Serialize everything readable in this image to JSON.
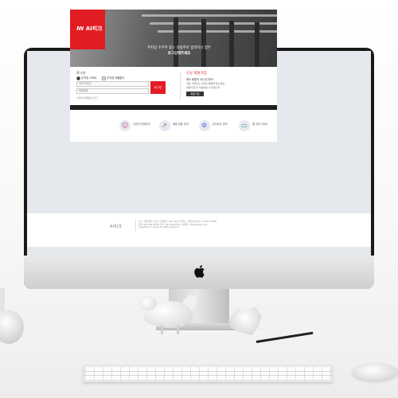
{
  "brand": {
    "logo_text": "AI피크"
  },
  "hero": {
    "line1": "주차장 수주주 찾는 설정주로 입력하신 업무",
    "line2": "로그인해주세요"
  },
  "login": {
    "title": "로그인",
    "option_personal": "주차장 스마트",
    "option_other": "주차장 자율없이",
    "id_placeholder": "이디 아이디",
    "pw_placeholder": "비밀번호",
    "button_label": "로그인",
    "find_text": "아이디/비밀번호 찾기"
  },
  "join": {
    "title": "신규 회원가입",
    "question": "에서 회원이 아니신가요?",
    "desc_line1": "지금 가입하고 다양한 혜택을 받으세요",
    "desc_line2": "회원가입 후 이용하실 수 있습니다",
    "button_label": "회원가입"
  },
  "services": [
    {
      "icon": "person-icon",
      "glyph": "☺",
      "label": "인공지 연계관리"
    },
    {
      "icon": "chart-icon",
      "glyph": "↗",
      "label": "매출 현황 관리"
    },
    {
      "icon": "gear-icon",
      "glyph": "⚙",
      "label": "유지보수 관리"
    },
    {
      "icon": "monitor-icon",
      "glyph": "▭",
      "label": "웹 관리 서비스"
    }
  ],
  "footer": {
    "logo_text": "AI피크",
    "line1": "주소: 서울특별시 강남구 테헤란로 123 | 대표: 홍길동 | 사업자등록번호: 123-45-67890",
    "line2": "전화: 02-1234-5678 | 팩스: 02-1234-5679 | 이메일: info@aipeak.co.kr",
    "line3": "copyright (c) aipeak all rights reserved."
  },
  "colors": {
    "accent": "#e21c23",
    "dark_bar": "#1f1f1f",
    "screen_bg": "#e5e9ed"
  }
}
